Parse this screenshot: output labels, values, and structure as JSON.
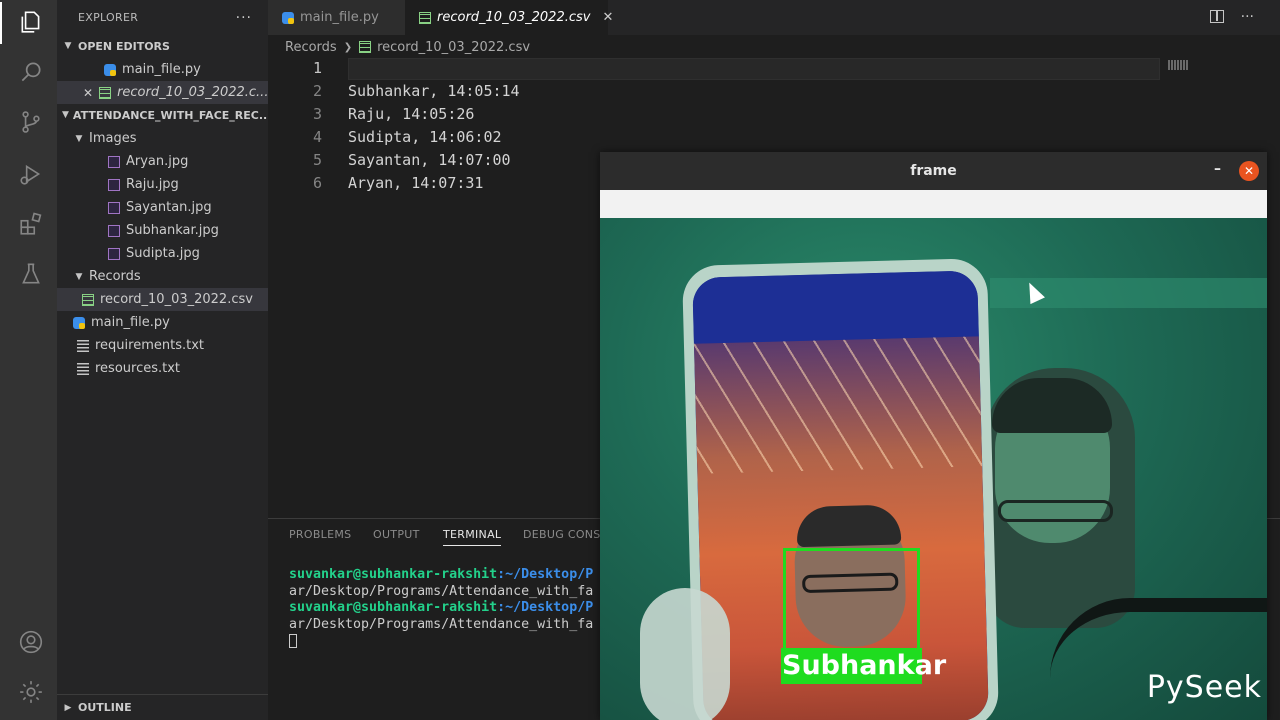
{
  "activity_bar": {
    "icons": [
      "explorer-icon",
      "search-icon",
      "source-control-icon",
      "run-debug-icon",
      "extensions-icon",
      "testing-icon",
      "account-icon",
      "settings-gear-icon"
    ]
  },
  "sidebar": {
    "header": "EXPLORER",
    "more": "···",
    "open_editors": {
      "title": "OPEN EDITORS",
      "items": [
        {
          "label": "main_file.py"
        },
        {
          "label": "record_10_03_2022.c..."
        }
      ]
    },
    "project": {
      "title": "ATTENDANCE_WITH_FACE_REC...",
      "folders": {
        "images": {
          "label": "Images",
          "files": [
            "Aryan.jpg",
            "Raju.jpg",
            "Sayantan.jpg",
            "Subhankar.jpg",
            "Sudipta.jpg"
          ]
        },
        "records": {
          "label": "Records",
          "files": [
            "record_10_03_2022.csv"
          ]
        }
      },
      "root_files": [
        "main_file.py",
        "requirements.txt",
        "resources.txt"
      ]
    },
    "outline": "OUTLINE"
  },
  "tabs": [
    {
      "label": "main_file.py"
    },
    {
      "label": "record_10_03_2022.csv",
      "close": "✕"
    }
  ],
  "tab_actions": {
    "more": "···"
  },
  "breadcrumb": {
    "folder": "Records",
    "file": "record_10_03_2022.csv"
  },
  "editor": {
    "lines": [
      {
        "num": "1",
        "text": ""
      },
      {
        "num": "2",
        "text": "Subhankar, 14:05:14"
      },
      {
        "num": "3",
        "text": "Raju, 14:05:26"
      },
      {
        "num": "4",
        "text": "Sudipta, 14:06:02"
      },
      {
        "num": "5",
        "text": "Sayantan, 14:07:00"
      },
      {
        "num": "6",
        "text": "Aryan, 14:07:31"
      }
    ]
  },
  "panel": {
    "tabs": [
      "PROBLEMS",
      "OUTPUT",
      "TERMINAL",
      "DEBUG CONSO"
    ],
    "terminal": {
      "line1_user": "suvankar@subhankar-rakshit",
      "line1_path": ":~/Desktop/P",
      "line2": "ar/Desktop/Programs/Attendance_with_fa",
      "line3_user": "suvankar@subhankar-rakshit",
      "line3_path": ":~/Desktop/P",
      "line4": "ar/Desktop/Programs/Attendance_with_fa"
    }
  },
  "frame_window": {
    "title": "frame",
    "minimize": "–",
    "close": "✕",
    "detected_name": "Subhankar"
  },
  "watermark": "PySeek",
  "colors": {
    "detection_box": "#1fdc1f",
    "close_button": "#e95420",
    "terminal_user": "#23d18b",
    "terminal_path": "#3b8eea"
  }
}
